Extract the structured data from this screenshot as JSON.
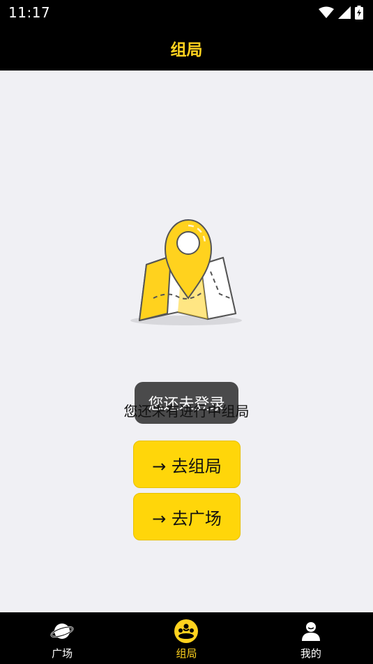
{
  "status_bar": {
    "time": "11:17"
  },
  "header": {
    "title": "组局"
  },
  "toast": {
    "text": "您还未登录"
  },
  "empty_state": {
    "message": "您还未有进行中组局"
  },
  "actions": [
    {
      "label": "→ 去组局"
    },
    {
      "label": "→ 去广场"
    }
  ],
  "tabs": [
    {
      "label": "广场",
      "icon": "planet-icon",
      "active": false
    },
    {
      "label": "组局",
      "icon": "group-icon",
      "active": true
    },
    {
      "label": "我的",
      "icon": "user-icon",
      "active": false
    }
  ],
  "colors": {
    "accent": "#ffd21e",
    "button": "#ffd60a",
    "bar": "#000000"
  }
}
